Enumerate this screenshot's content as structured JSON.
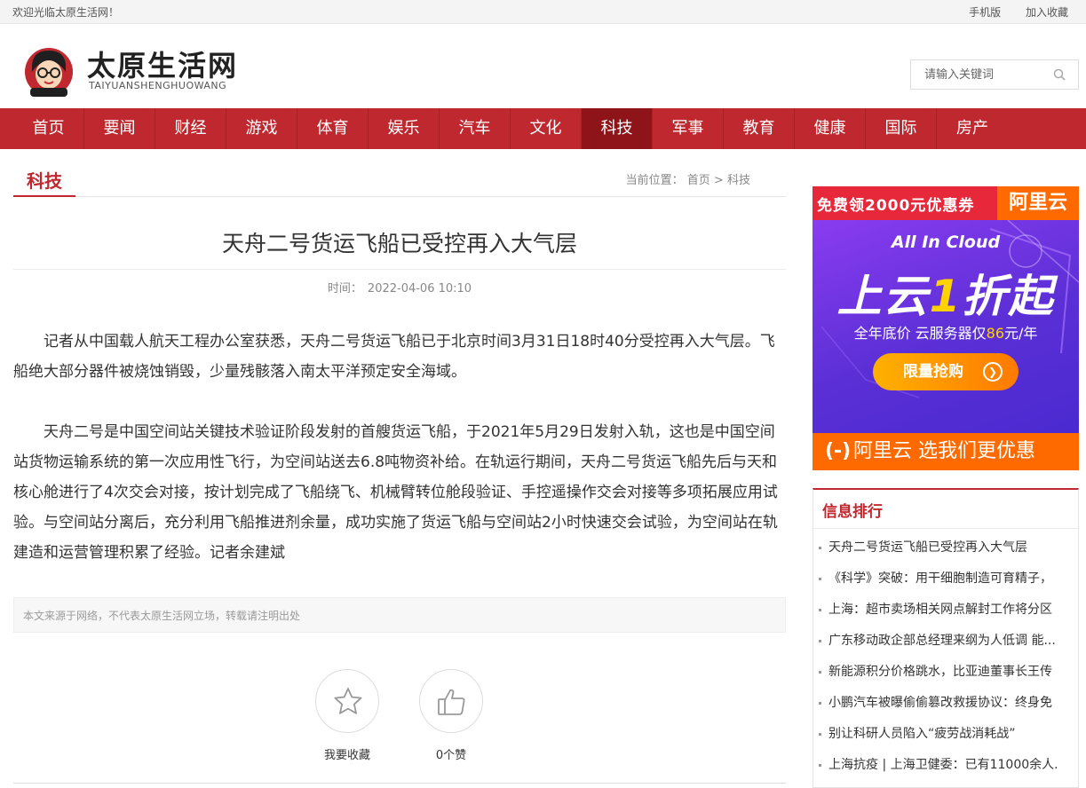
{
  "topbar": {
    "welcome": "欢迎光临太原生活网！",
    "mobile": "手机版",
    "favorite": "加入收藏"
  },
  "header": {
    "site_name": "太原生活网",
    "site_pinyin": "TAIYUANSHENGHUOWANG",
    "search_placeholder": "请输入关键词"
  },
  "nav": {
    "items": [
      "首页",
      "要闻",
      "财经",
      "游戏",
      "体育",
      "娱乐",
      "汽车",
      "文化",
      "科技",
      "军事",
      "教育",
      "健康",
      "国际",
      "房产"
    ],
    "active": "科技"
  },
  "section": {
    "title": "科技",
    "breadcrumb_prefix": "当前位置：",
    "breadcrumb_home": "首页",
    "breadcrumb_sep": ">",
    "breadcrumb_current": "科技"
  },
  "article": {
    "title": "天舟二号货运飞船已受控再入大气层",
    "time_label": "时间：",
    "time_value": "2022-04-06 10:10",
    "para1": "记者从中国载人航天工程办公室获悉，天舟二号货运飞船已于北京时间3月31日18时40分受控再入大气层。飞船绝大部分器件被烧蚀销毁，少量残骸落入南太平洋预定安全海域。",
    "para2": "天舟二号是中国空间站关键技术验证阶段发射的首艘货运飞船，于2021年5月29日发射入轨，这也是中国空间站货物运输系统的第一次应用性飞行，为空间站送去6.8吨物资补给。在轨运行期间，天舟二号货运飞船先后与天和核心舱进行了4次交会对接，按计划完成了飞船绕飞、机械臂转位舱段验证、手控遥操作交会对接等多项拓展应用试验。与空间站分离后，充分利用飞船推进剂余量，成功实施了货运飞船与空间站2小时快速交会试验，为空间站在轨建造和运营管理积累了经验。记者余建斌",
    "disclaimer": "本文来源于网络，不代表太原生活网立场，转载请注明出处",
    "collect_label": "我要收藏",
    "like_label": "0个赞"
  },
  "ad": {
    "free_coupon": "免费领2000元优惠券",
    "brand": "阿里云",
    "tagline": "All In Cloud",
    "headline_a": "上云",
    "headline_one": "1",
    "headline_b": "折起",
    "subline_a": "全年底价  云服务器仅",
    "subline_price": "86",
    "subline_b": "元/年",
    "button": "限量抢购",
    "bottom_mark": "(-)",
    "bottom_text": "阿里云 选我们更优惠"
  },
  "ranking": {
    "title": "信息排行",
    "items": [
      "天舟二号货运飞船已受控再入大气层",
      "《科学》突破：用干细胞制造可育精子，",
      "上海：超市卖场相关网点解封工作将分区",
      "广东移动政企部总经理来纲为人低调 能...",
      "新能源积分价格跳水，比亚迪董事长王传",
      "小鹏汽车被曝偷偷篡改救援协议：终身免",
      "别让科研人员陷入“疲劳战消耗战”",
      "上海抗疫 | 上海卫健委：已有11000余人."
    ]
  },
  "colors": {
    "brand_red": "#c0282f",
    "nav_active": "#8e1419",
    "aliyun_orange": "#ff6a00"
  }
}
